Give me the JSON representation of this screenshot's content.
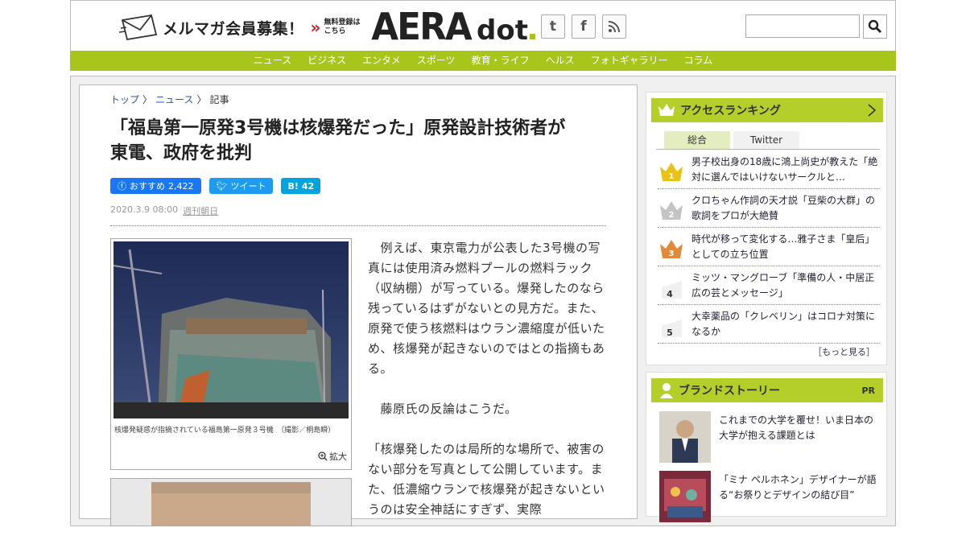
{
  "header": {
    "mailmag_text": "メルマガ会員募集！",
    "free_line1": "無料登録は",
    "free_line2": "こちら",
    "logo_main": "AERA",
    "logo_sub": "dot",
    "social": [
      "twitter-icon",
      "facebook-icon",
      "rss-icon"
    ],
    "search_placeholder": "",
    "brand_color": "#a8c51c"
  },
  "nav": {
    "items": [
      "ニュース",
      "ビジネス",
      "エンタメ",
      "スポーツ",
      "教育・ライフ",
      "ヘルス",
      "フォトギャラリー",
      "コラム"
    ]
  },
  "article": {
    "breadcrumb": [
      "トップ",
      "ニュース",
      "記事"
    ],
    "title_line1": "「福島第一原発3号機は核爆発だった」原発設計技術者が",
    "title_line2": "東電、政府を批判",
    "share": {
      "fb_label": "おすすめ",
      "fb_count": "2,422",
      "tw_label": "ツイート",
      "hb_label": "B!",
      "hb_count": "42"
    },
    "date": "2020.3.9 08:00",
    "source": "週刊朝日",
    "caption": "核爆発疑惑が指摘されている福島第一原発３号機　（撮影／桐島瞬）",
    "zoom_label": "拡大",
    "paragraphs": [
      "　例えば、東京電力が公表した3号機の写真には使用済み燃料プールの燃料ラック（収納棚）が写っている。爆発したのなら残っているはずがないとの見方だ。また、原発で使う核燃料はウラン濃縮度が低いため、核爆発が起きないのではとの指摘もある。",
      "　藤原氏の反論はこうだ。",
      "「核爆発したのは局所的な場所で、被害のない部分を写真として公開しています。また、低濃縮ウランで核爆発が起きないというのは安全神話にすぎず、実際"
    ]
  },
  "ranking": {
    "title": "アクセスランキング",
    "tabs": [
      "総合",
      "Twitter"
    ],
    "items": [
      {
        "rank": "1",
        "title": "男子校出身の18歳に鴻上尚史が教えた「絶対に選んではいけないサークルと…"
      },
      {
        "rank": "2",
        "title": "クロちゃん作詞の天才説「豆柴の大群」の歌詞をプロが大絶賛"
      },
      {
        "rank": "3",
        "title": "時代が移って変化する…雅子さま「皇后」としての立ち位置"
      },
      {
        "rank": "4",
        "title": "ミッツ・マングローブ「準備の人・中居正広の芸とメッセージ」"
      },
      {
        "rank": "5",
        "title": "大幸薬品の「クレベリン」はコロナ対策になるか"
      }
    ],
    "more": "［もっと見る］"
  },
  "brand": {
    "title": "ブランドストーリー",
    "pr": "PR",
    "stories": [
      {
        "title": "これまでの大学を覆せ！いま日本の大学が抱える課題とは"
      },
      {
        "title": "「ミナ ペルホネン」デザイナーが語る“お祭りとデザインの結び目”"
      }
    ]
  }
}
